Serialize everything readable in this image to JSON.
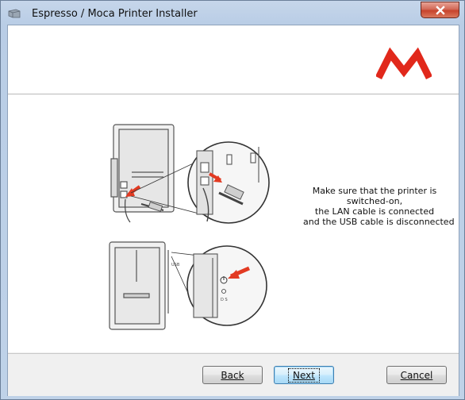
{
  "window": {
    "title": "Espresso / Moca Printer Installer",
    "close_icon": "close-icon"
  },
  "logo": {
    "icon": "brand-logo-icon",
    "color": "#e1281b"
  },
  "illustration": {
    "icon": "printer-setup-illustration",
    "arrow_color": "#e23a22"
  },
  "message": {
    "line1": "Make sure that the printer is",
    "line2": "switched-on,",
    "line3": "the LAN cable is connected",
    "line4": "and the USB cable is disconnected"
  },
  "buttons": {
    "back": "Back",
    "next": "Next",
    "cancel": "Cancel"
  }
}
